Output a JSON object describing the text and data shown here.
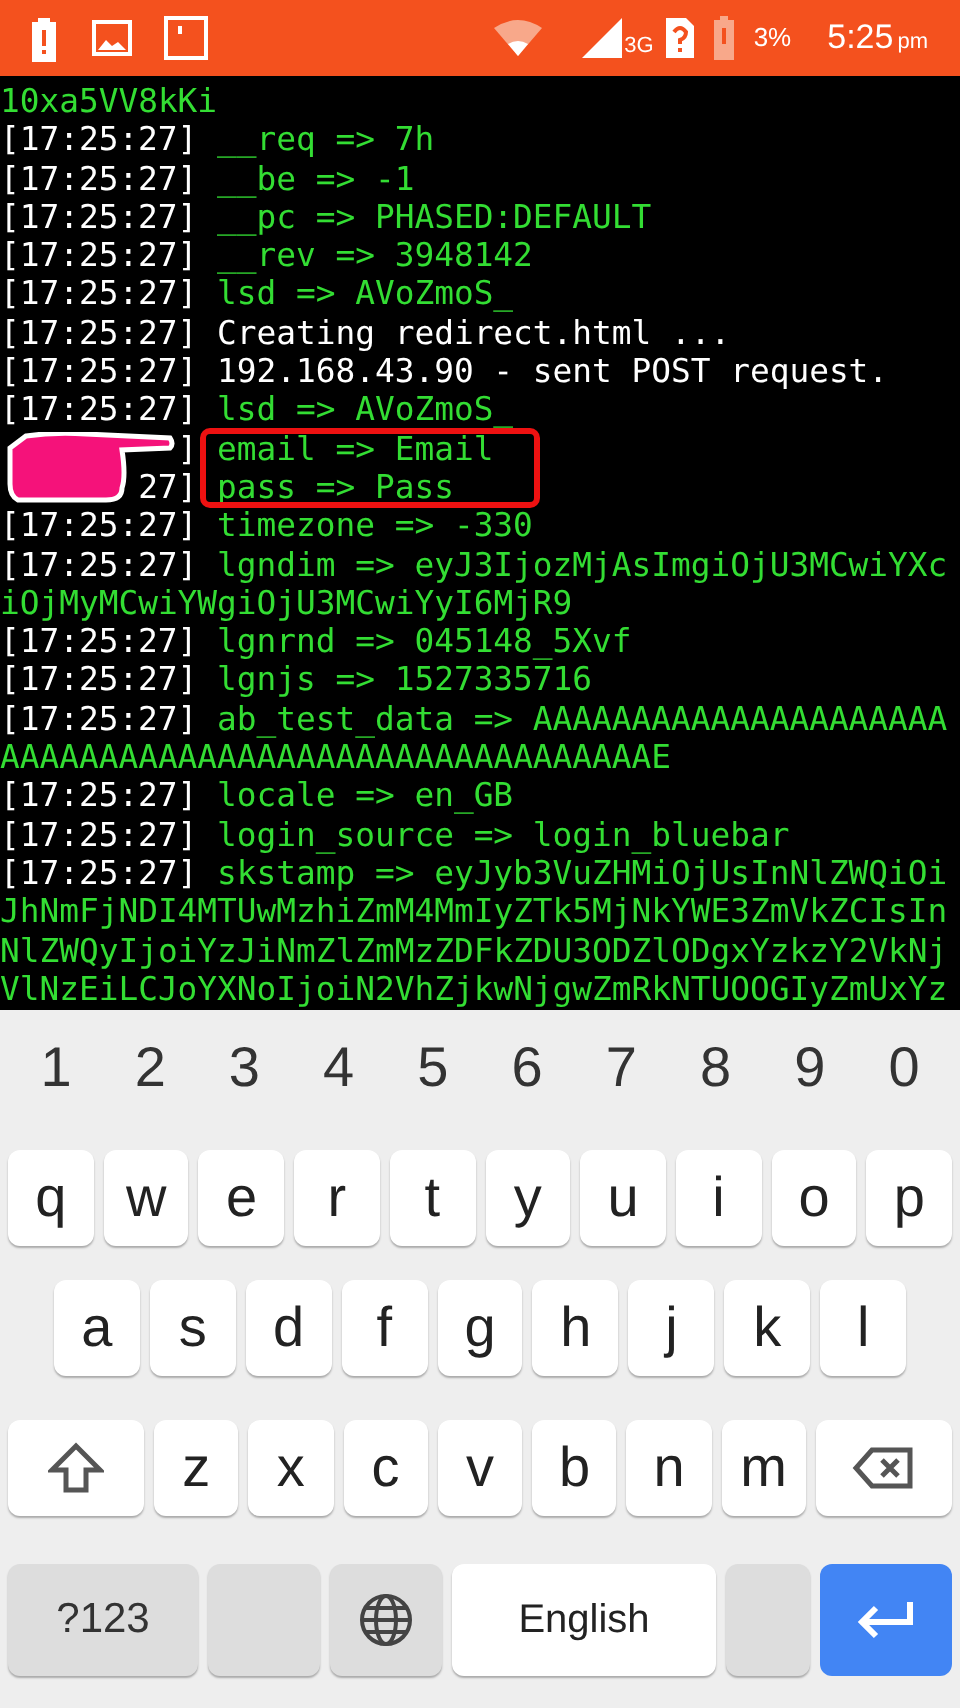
{
  "status_bar": {
    "network": "3G",
    "battery": "3%",
    "time": "5:25",
    "ampm": "pm"
  },
  "terminal": {
    "lines": [
      {
        "kind": "wrap",
        "text": "10xa5VV8kKi"
      },
      {
        "kind": "param",
        "time": "[17:25:27]",
        "text": "__req => 7h"
      },
      {
        "kind": "param",
        "time": "[17:25:27]",
        "text": "__be => -1"
      },
      {
        "kind": "param",
        "time": "[17:25:27]",
        "text": "__pc => PHASED:DEFAULT"
      },
      {
        "kind": "param",
        "time": "[17:25:27]",
        "text": "__rev => 3948142"
      },
      {
        "kind": "param",
        "time": "[17:25:27]",
        "text": "lsd => AVoZmoS_"
      },
      {
        "kind": "info",
        "time": "[17:25:27]",
        "text": "Creating redirect.html ..."
      },
      {
        "kind": "info",
        "time": "[17:25:27]",
        "text": "192.168.43.90 - sent POST request."
      },
      {
        "kind": "param",
        "time": "[17:25:27]",
        "text": "lsd => AVoZmoS_"
      },
      {
        "kind": "param",
        "time": "]",
        "text": "email => Email"
      },
      {
        "kind": "param",
        "time": "27]",
        "text": "pass => Pass"
      },
      {
        "kind": "param",
        "time": "[17:25:27]",
        "text": "timezone => -330"
      },
      {
        "kind": "param",
        "time": "[17:25:27]",
        "text": "lgndim => eyJ3IjozMjAsImgiOjU3MCwiYXc"
      },
      {
        "kind": "wrap",
        "text": "iOjMyMCwiYWgiOjU3MCwiYyI6MjR9"
      },
      {
        "kind": "param",
        "time": "[17:25:27]",
        "text": "lgnrnd => 045148_5Xvf"
      },
      {
        "kind": "param",
        "time": "[17:25:27]",
        "text": "lgnjs => 1527335716"
      },
      {
        "kind": "param",
        "time": "[17:25:27]",
        "text": "ab_test_data => AAAAAAAAAAAAAAAAAAAAA"
      },
      {
        "kind": "wrap",
        "text": "AAAAAAAAAAAAAAAAAAAAAAAAAAAAAAAAAE"
      },
      {
        "kind": "param",
        "time": "[17:25:27]",
        "text": "locale => en_GB"
      },
      {
        "kind": "param",
        "time": "[17:25:27]",
        "text": "login_source => login_bluebar"
      },
      {
        "kind": "param",
        "time": "[17:25:27]",
        "text": "skstamp => eyJyb3VuZHMiOjUsInNlZWQiOi"
      },
      {
        "kind": "wrap",
        "text": "JhNmFjNDI4MTUwMzhiZmM4MmIyZTk5MjNkYWE3ZmVkZCIsIn"
      },
      {
        "kind": "wrap",
        "text": "NlZWQyIjoiYzJiNmZlZmMzZDFkZDU3ODZlODgxYzkzY2VkNj"
      },
      {
        "kind": "wrap",
        "text": "VlNzEiLCJoYXNoIjoiN2VhZjkwNjgwZmRkNTUOOGIyZmUxYz"
      }
    ]
  },
  "keyboard": {
    "digits": [
      "1",
      "2",
      "3",
      "4",
      "5",
      "6",
      "7",
      "8",
      "9",
      "0"
    ],
    "rows": [
      [
        "q",
        "w",
        "e",
        "r",
        "t",
        "y",
        "u",
        "i",
        "o",
        "p"
      ],
      [
        "a",
        "s",
        "d",
        "f",
        "g",
        "h",
        "j",
        "k",
        "l"
      ],
      [
        "z",
        "x",
        "c",
        "v",
        "b",
        "n",
        "m"
      ]
    ],
    "symbols_key": "?123",
    "space_key": "English"
  }
}
